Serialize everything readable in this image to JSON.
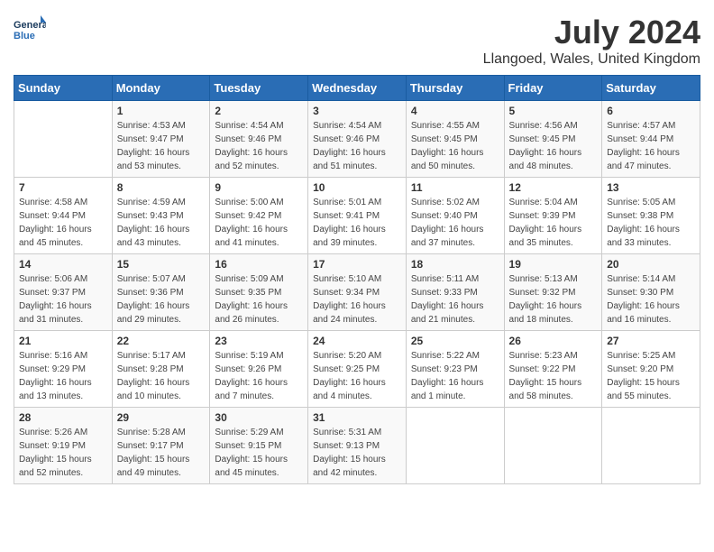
{
  "logo": {
    "line1": "General",
    "line2": "Blue"
  },
  "title": "July 2024",
  "location": "Llangoed, Wales, United Kingdom",
  "days_of_week": [
    "Sunday",
    "Monday",
    "Tuesday",
    "Wednesday",
    "Thursday",
    "Friday",
    "Saturday"
  ],
  "weeks": [
    [
      {
        "day": "",
        "sunrise": "",
        "sunset": "",
        "daylight": ""
      },
      {
        "day": "1",
        "sunrise": "Sunrise: 4:53 AM",
        "sunset": "Sunset: 9:47 PM",
        "daylight": "Daylight: 16 hours and 53 minutes."
      },
      {
        "day": "2",
        "sunrise": "Sunrise: 4:54 AM",
        "sunset": "Sunset: 9:46 PM",
        "daylight": "Daylight: 16 hours and 52 minutes."
      },
      {
        "day": "3",
        "sunrise": "Sunrise: 4:54 AM",
        "sunset": "Sunset: 9:46 PM",
        "daylight": "Daylight: 16 hours and 51 minutes."
      },
      {
        "day": "4",
        "sunrise": "Sunrise: 4:55 AM",
        "sunset": "Sunset: 9:45 PM",
        "daylight": "Daylight: 16 hours and 50 minutes."
      },
      {
        "day": "5",
        "sunrise": "Sunrise: 4:56 AM",
        "sunset": "Sunset: 9:45 PM",
        "daylight": "Daylight: 16 hours and 48 minutes."
      },
      {
        "day": "6",
        "sunrise": "Sunrise: 4:57 AM",
        "sunset": "Sunset: 9:44 PM",
        "daylight": "Daylight: 16 hours and 47 minutes."
      }
    ],
    [
      {
        "day": "7",
        "sunrise": "Sunrise: 4:58 AM",
        "sunset": "Sunset: 9:44 PM",
        "daylight": "Daylight: 16 hours and 45 minutes."
      },
      {
        "day": "8",
        "sunrise": "Sunrise: 4:59 AM",
        "sunset": "Sunset: 9:43 PM",
        "daylight": "Daylight: 16 hours and 43 minutes."
      },
      {
        "day": "9",
        "sunrise": "Sunrise: 5:00 AM",
        "sunset": "Sunset: 9:42 PM",
        "daylight": "Daylight: 16 hours and 41 minutes."
      },
      {
        "day": "10",
        "sunrise": "Sunrise: 5:01 AM",
        "sunset": "Sunset: 9:41 PM",
        "daylight": "Daylight: 16 hours and 39 minutes."
      },
      {
        "day": "11",
        "sunrise": "Sunrise: 5:02 AM",
        "sunset": "Sunset: 9:40 PM",
        "daylight": "Daylight: 16 hours and 37 minutes."
      },
      {
        "day": "12",
        "sunrise": "Sunrise: 5:04 AM",
        "sunset": "Sunset: 9:39 PM",
        "daylight": "Daylight: 16 hours and 35 minutes."
      },
      {
        "day": "13",
        "sunrise": "Sunrise: 5:05 AM",
        "sunset": "Sunset: 9:38 PM",
        "daylight": "Daylight: 16 hours and 33 minutes."
      }
    ],
    [
      {
        "day": "14",
        "sunrise": "Sunrise: 5:06 AM",
        "sunset": "Sunset: 9:37 PM",
        "daylight": "Daylight: 16 hours and 31 minutes."
      },
      {
        "day": "15",
        "sunrise": "Sunrise: 5:07 AM",
        "sunset": "Sunset: 9:36 PM",
        "daylight": "Daylight: 16 hours and 29 minutes."
      },
      {
        "day": "16",
        "sunrise": "Sunrise: 5:09 AM",
        "sunset": "Sunset: 9:35 PM",
        "daylight": "Daylight: 16 hours and 26 minutes."
      },
      {
        "day": "17",
        "sunrise": "Sunrise: 5:10 AM",
        "sunset": "Sunset: 9:34 PM",
        "daylight": "Daylight: 16 hours and 24 minutes."
      },
      {
        "day": "18",
        "sunrise": "Sunrise: 5:11 AM",
        "sunset": "Sunset: 9:33 PM",
        "daylight": "Daylight: 16 hours and 21 minutes."
      },
      {
        "day": "19",
        "sunrise": "Sunrise: 5:13 AM",
        "sunset": "Sunset: 9:32 PM",
        "daylight": "Daylight: 16 hours and 18 minutes."
      },
      {
        "day": "20",
        "sunrise": "Sunrise: 5:14 AM",
        "sunset": "Sunset: 9:30 PM",
        "daylight": "Daylight: 16 hours and 16 minutes."
      }
    ],
    [
      {
        "day": "21",
        "sunrise": "Sunrise: 5:16 AM",
        "sunset": "Sunset: 9:29 PM",
        "daylight": "Daylight: 16 hours and 13 minutes."
      },
      {
        "day": "22",
        "sunrise": "Sunrise: 5:17 AM",
        "sunset": "Sunset: 9:28 PM",
        "daylight": "Daylight: 16 hours and 10 minutes."
      },
      {
        "day": "23",
        "sunrise": "Sunrise: 5:19 AM",
        "sunset": "Sunset: 9:26 PM",
        "daylight": "Daylight: 16 hours and 7 minutes."
      },
      {
        "day": "24",
        "sunrise": "Sunrise: 5:20 AM",
        "sunset": "Sunset: 9:25 PM",
        "daylight": "Daylight: 16 hours and 4 minutes."
      },
      {
        "day": "25",
        "sunrise": "Sunrise: 5:22 AM",
        "sunset": "Sunset: 9:23 PM",
        "daylight": "Daylight: 16 hours and 1 minute."
      },
      {
        "day": "26",
        "sunrise": "Sunrise: 5:23 AM",
        "sunset": "Sunset: 9:22 PM",
        "daylight": "Daylight: 15 hours and 58 minutes."
      },
      {
        "day": "27",
        "sunrise": "Sunrise: 5:25 AM",
        "sunset": "Sunset: 9:20 PM",
        "daylight": "Daylight: 15 hours and 55 minutes."
      }
    ],
    [
      {
        "day": "28",
        "sunrise": "Sunrise: 5:26 AM",
        "sunset": "Sunset: 9:19 PM",
        "daylight": "Daylight: 15 hours and 52 minutes."
      },
      {
        "day": "29",
        "sunrise": "Sunrise: 5:28 AM",
        "sunset": "Sunset: 9:17 PM",
        "daylight": "Daylight: 15 hours and 49 minutes."
      },
      {
        "day": "30",
        "sunrise": "Sunrise: 5:29 AM",
        "sunset": "Sunset: 9:15 PM",
        "daylight": "Daylight: 15 hours and 45 minutes."
      },
      {
        "day": "31",
        "sunrise": "Sunrise: 5:31 AM",
        "sunset": "Sunset: 9:13 PM",
        "daylight": "Daylight: 15 hours and 42 minutes."
      },
      {
        "day": "",
        "sunrise": "",
        "sunset": "",
        "daylight": ""
      },
      {
        "day": "",
        "sunrise": "",
        "sunset": "",
        "daylight": ""
      },
      {
        "day": "",
        "sunrise": "",
        "sunset": "",
        "daylight": ""
      }
    ]
  ]
}
